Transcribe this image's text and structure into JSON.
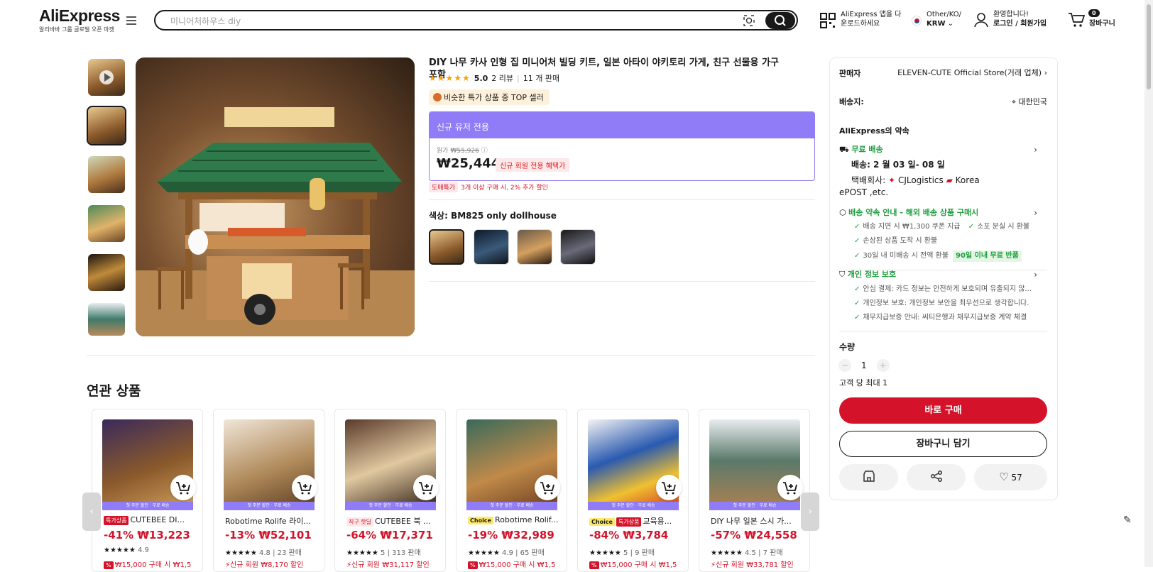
{
  "header": {
    "logo": "AliExpress",
    "logo_sub": "알리바바 그룹 글로벌 오픈 마켓",
    "search_placeholder": "미니어처하우스 diy",
    "app_line1": "AliExpress 앱을 다",
    "app_line2": "운로드하세요",
    "lang_line1": "Other/KO/",
    "lang_line2": "KRW",
    "welcome": "환영합니다!",
    "login": "로그인 / 회원가입",
    "cart_count": "0",
    "cart_label": "장바구니"
  },
  "product": {
    "title": "DIY 나무 카사 인형 집 미니어처 빌딩 키트, 일본 아타이 야키토리 가게, 친구 선물용 가구 포함",
    "rating": "5.0",
    "reviews": "2 리뷰",
    "sold": "11 개 판매",
    "top_badge": "비슷한 특가 상품 중 TOP 셀러",
    "promo_header": "신규 유저 전용",
    "orig_label": "원가",
    "orig_price": "₩55,926",
    "price": "₩25,444",
    "member_tag": "신규 회원 전용 혜택가",
    "bulk_badge": "도매특가",
    "bulk_text": "3개 이상 구매 시, 2% 추가 할인",
    "color_label": "색상: BM825 only dollhouse"
  },
  "seller": {
    "label": "판매자",
    "name": "ELEVEN-CUTE Official Store(거래 업체)",
    "ship_label": "배송지:",
    "ship_to": "대한민국",
    "promise_title": "AliExpress의 약속",
    "free_ship": "무료 배송",
    "delivery": "배송: 2 월 03 일- 08 일",
    "carrier_label": "택배회사:",
    "carrier1": "CJLogistics",
    "carrier2": "Korea",
    "carrier3": "ePOST ,etc.",
    "policy_title": "배송 약속 안내 - 해외 배송 상품 구매시",
    "p1": "배송 지연 시 ₩1,300 쿠폰 지급",
    "p2": "소포 분실 시 환불",
    "p3": "손상된 상품 도착 시 환불",
    "p4": "30일 내 미배송 시 전액 환불",
    "p4_badge": "90일 이내 무료 반품",
    "privacy_title": "개인 정보 보호",
    "q1": "안심 결제: 카드 정보는 안전하게 보호되며 유출되지 않...",
    "q2": "개인정보 보호: 개인정보 보안을 최우선으로 생각합니다.",
    "q3": "채무지급보증 안내: 씨티은행과 채무지급보증 계약 체결",
    "qty_label": "수량",
    "qty_value": "1",
    "max": "고객 당 최대 1",
    "buy": "바로 구매",
    "add_cart": "장바구니 담기",
    "likes": "57"
  },
  "related": {
    "title": "연관 상품",
    "strip": "첫 주문 할인 · 무료 배송",
    "items": [
      {
        "tag": "특가상품",
        "name": "CUTEBEE DI...",
        "price": "-41% ₩13,223",
        "rating": "4.9",
        "sold": "",
        "coupon": "₩15,000 구매 시 ₩1,5"
      },
      {
        "tag": "",
        "name": "Robotime Rolife 라이...",
        "price": "-13% ₩52,101",
        "rating": "4.8",
        "sold": "23 판매",
        "coupon": "신규 회원 ₩8,170 할인"
      },
      {
        "tag": "직구 핫딜",
        "name": "CUTEBEE 북 ...",
        "price": "-64% ₩17,371",
        "rating": "5",
        "sold": "313 판매",
        "coupon": "신규 회원 ₩31,117 할인"
      },
      {
        "tag": "Choice",
        "name": "Robotime Rolif...",
        "price": "-19% ₩32,989",
        "rating": "4.9",
        "sold": "65 판매",
        "coupon": "₩15,000 구매 시 ₩1,5"
      },
      {
        "tag": "Choice",
        "tag2": "특가상품",
        "name": "교육용...",
        "price": "-84% ₩3,784",
        "rating": "5",
        "sold": "9 판매",
        "coupon": "₩15,000 구매 시 ₩1,5"
      },
      {
        "tag": "",
        "name": "DIY 나무 일본 스시 가...",
        "price": "-57% ₩24,558",
        "rating": "4.5",
        "sold": "7 판매",
        "coupon": "신규 회원 ₩33,781 할인"
      }
    ]
  }
}
